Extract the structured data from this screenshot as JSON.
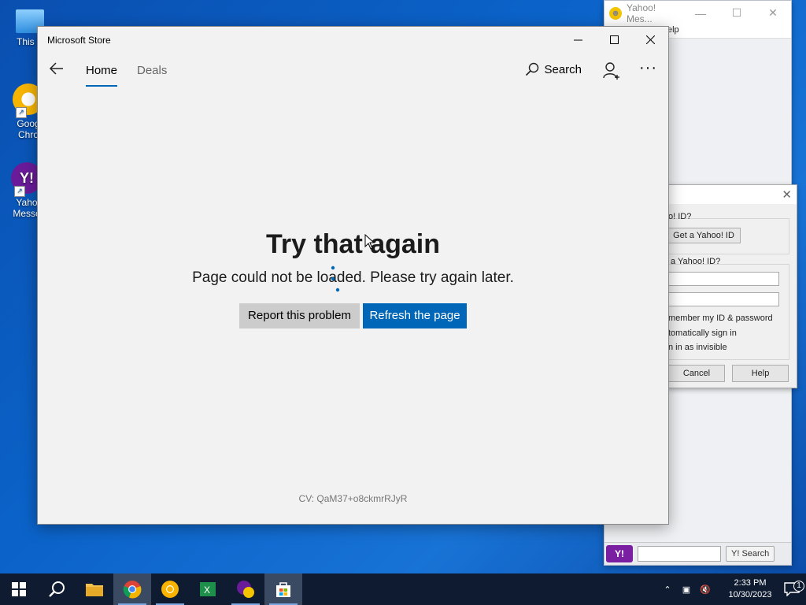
{
  "desktop": {
    "icons": [
      {
        "label": "This P"
      },
      {
        "label": "Goog\nChro"
      },
      {
        "label": "Yaho\nMesse"
      }
    ]
  },
  "yahoo_window": {
    "title": "Yahoo! Mes...",
    "menu_fragment": "elp",
    "bottom_badge": "Y!",
    "search_button": "Y! Search"
  },
  "yahoo_dialog": {
    "question1": "o! ID?",
    "get_id_button": "Get a Yahoo! ID",
    "question2": "a Yahoo! ID?",
    "remember": "member my ID & password",
    "auto_signin": "tomatically sign in",
    "invisible": "n in as invisible",
    "cancel": "Cancel",
    "help": "Help"
  },
  "store": {
    "app_title": "Microsoft Store",
    "nav": {
      "home": "Home",
      "deals": "Deals",
      "search": "Search"
    },
    "error": {
      "title": "Try that again",
      "subtitle": "Page could not be loaded. Please try again later.",
      "report_button": "Report this problem",
      "refresh_button": "Refresh the page",
      "cv": "CV: QaM37+o8ckmrRJyR"
    },
    "accent_color": "#0067b8"
  },
  "taskbar": {
    "time": "2:33 PM",
    "date": "10/30/2023",
    "notifications": "1"
  }
}
